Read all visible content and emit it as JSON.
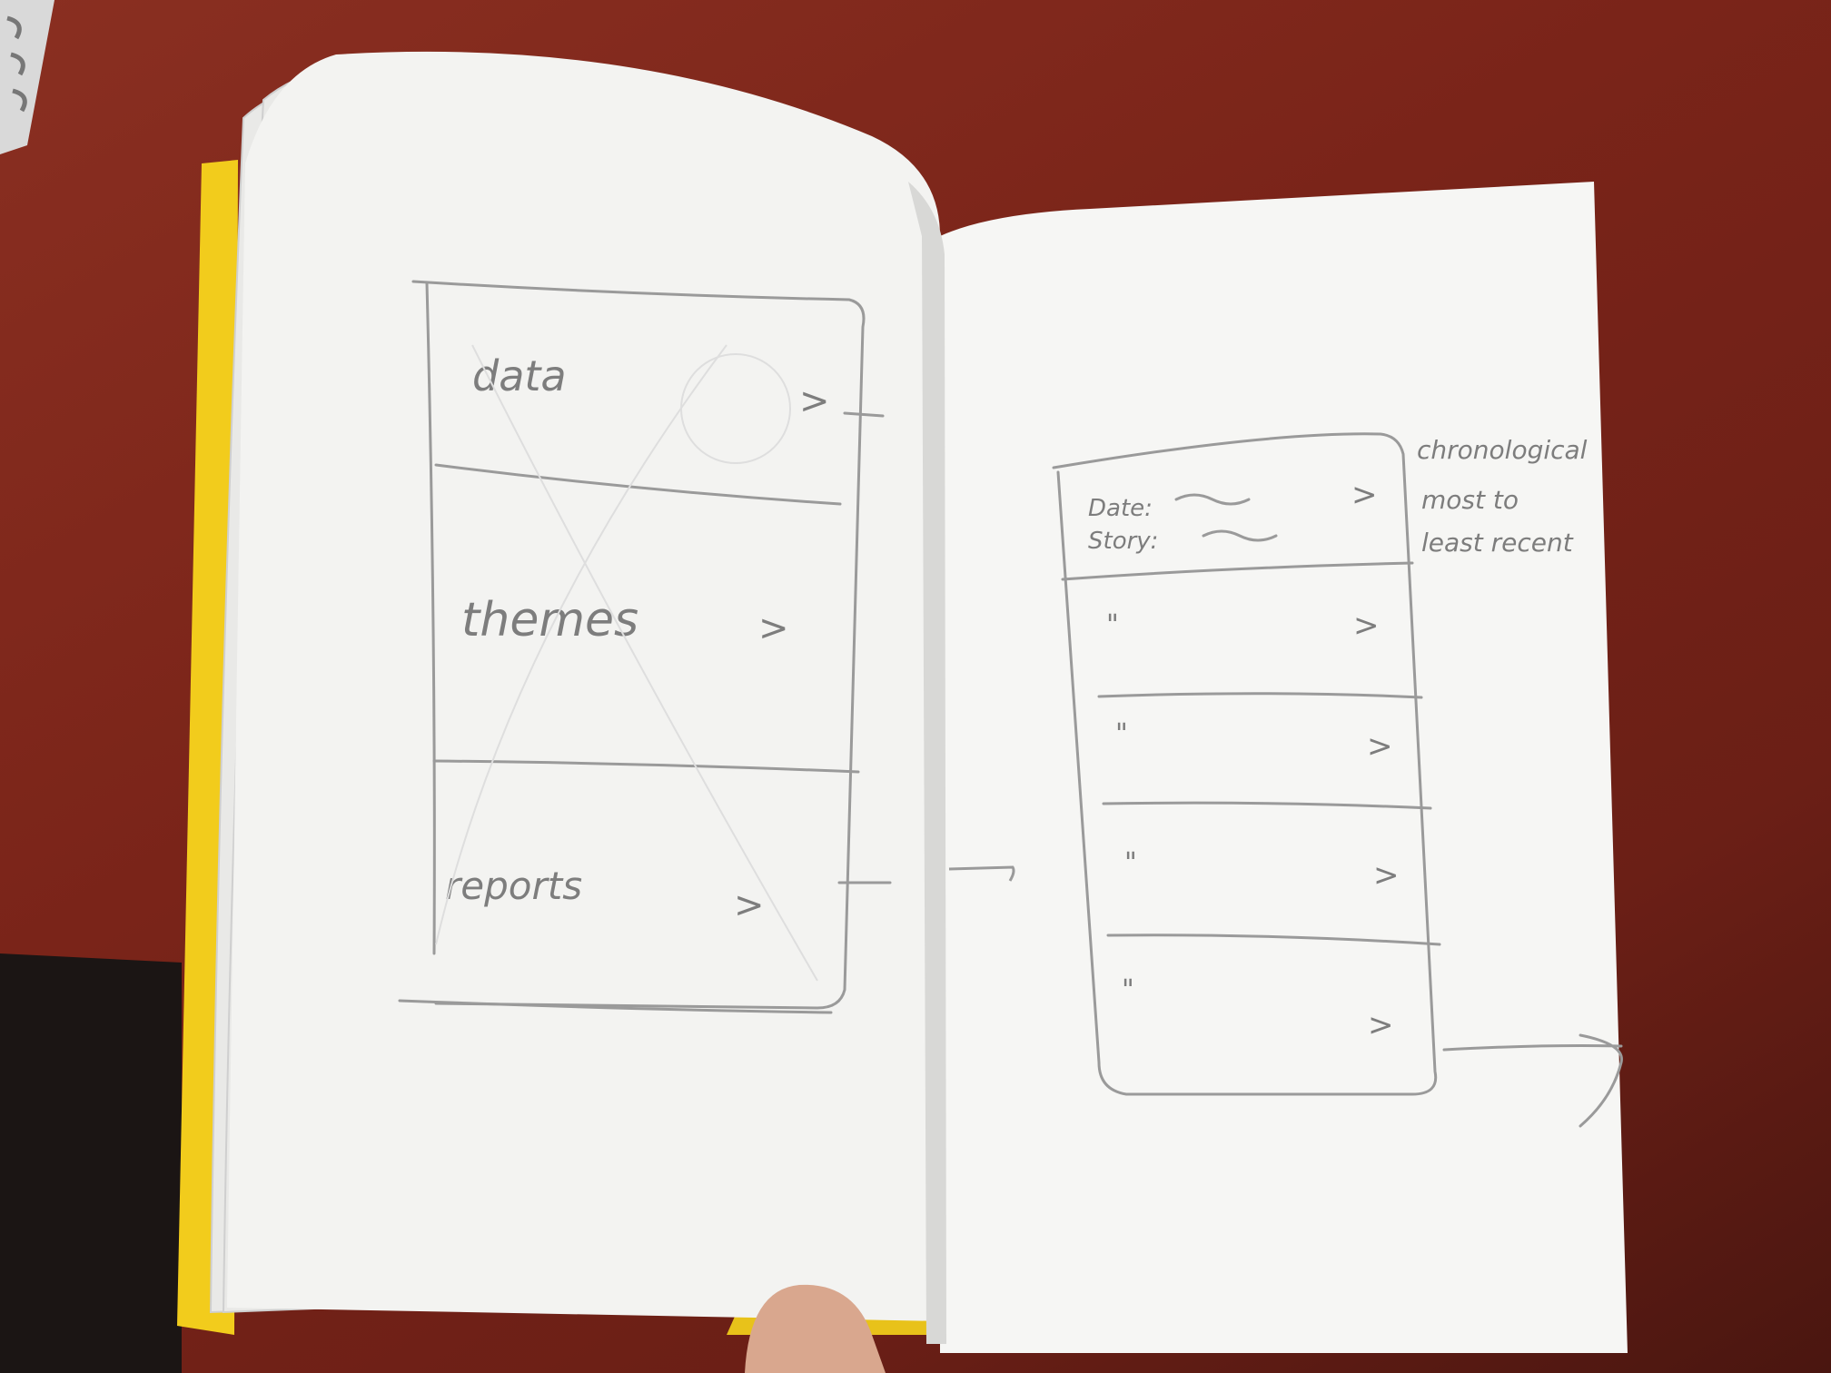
{
  "left_page": {
    "items": [
      {
        "label": "data",
        "arrow": ">"
      },
      {
        "label": "themes",
        "arrow": ">"
      },
      {
        "label": "reports",
        "arrow": ">"
      }
    ]
  },
  "right_page": {
    "first_row": {
      "date_label": "Date:",
      "story_label": "Story:",
      "arrow": ">"
    },
    "rows": [
      {
        "mark": "\"",
        "arrow": ">"
      },
      {
        "mark": "\"",
        "arrow": ">"
      },
      {
        "mark": "\"",
        "arrow": ">"
      },
      {
        "mark": "\"",
        "arrow": ">"
      }
    ],
    "annotation": [
      "chronological",
      "most to",
      "least recent"
    ]
  },
  "colors": {
    "desk": "#7a2419",
    "paper": "#f4f4f2",
    "pencil": "#8c8c8c",
    "cover": "#f2cc1c"
  }
}
